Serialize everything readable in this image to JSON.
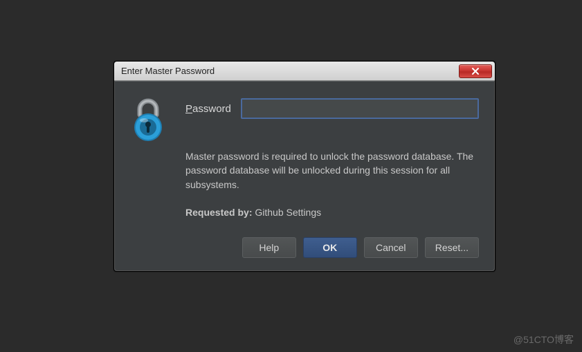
{
  "dialog": {
    "title": "Enter Master Password",
    "password_label_prefix": "P",
    "password_label_rest": "assword",
    "password_value": "",
    "description": "Master password is required to unlock the password database. The password database will be unlocked during this session for all subsystems.",
    "requested_by_label": "Requested by",
    "requested_by_value": "Github Settings"
  },
  "buttons": {
    "help": "Help",
    "ok": "OK",
    "cancel": "Cancel",
    "reset": "Reset..."
  },
  "watermark": "@51CTO博客",
  "colors": {
    "accent": "#3f5e8f",
    "lock_body": "#2b9fd9",
    "lock_inner": "#1e7fb3"
  }
}
